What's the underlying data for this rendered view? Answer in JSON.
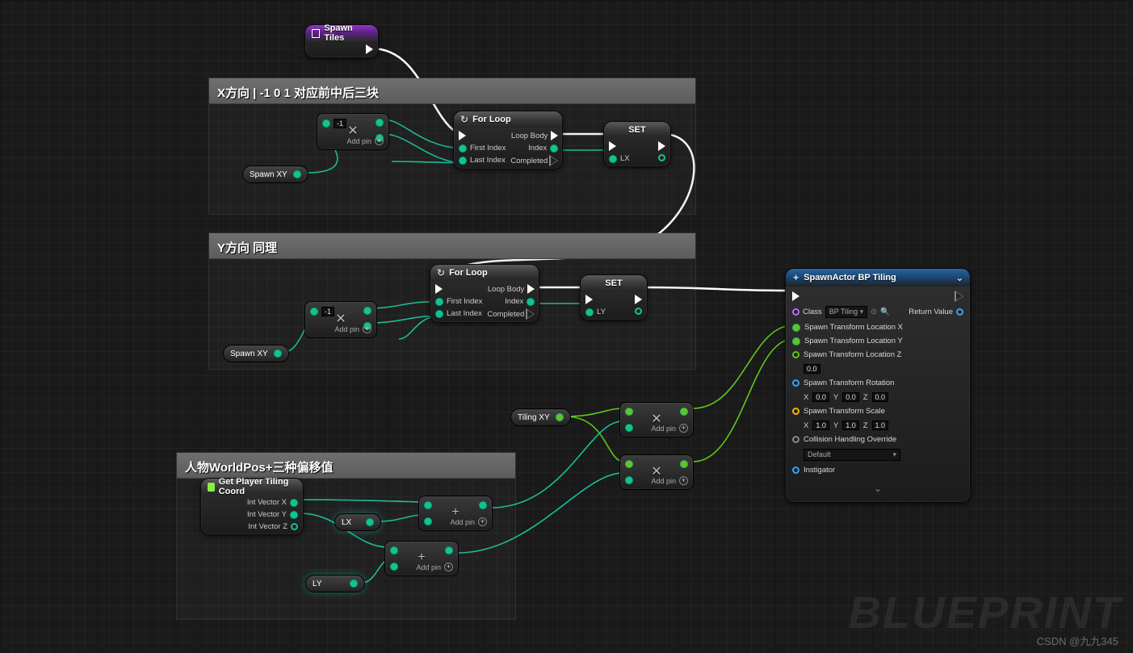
{
  "event": {
    "title": "Spawn Tiles"
  },
  "comments": {
    "x": {
      "title": "X方向 | -1 0 1 对应前中后三块"
    },
    "y": {
      "title": "Y方向 同理"
    },
    "w": {
      "title": "人物WorldPos+三种偏移值"
    }
  },
  "forloop": {
    "title": "For Loop",
    "first": "First Index",
    "last": "Last Index",
    "body": "Loop Body",
    "index": "Index",
    "completed": "Completed"
  },
  "set": {
    "title": "SET",
    "lx": "LX",
    "ly": "LY"
  },
  "makearr": {
    "addpin": "Add pin",
    "neg1": "-1"
  },
  "vars": {
    "spawnxy": "Spawn XY",
    "tilingxy": "Tiling XY",
    "lx": "LX",
    "ly": "LY"
  },
  "getplayer": {
    "title": "Get Player Tiling Coord",
    "x": "Int Vector X",
    "y": "Int Vector Y",
    "z": "Int Vector Z"
  },
  "spawn": {
    "title": "SpawnActor BP Tiling",
    "class": "Class",
    "classval": "BP Tiling",
    "retval": "Return Value",
    "locx": "Spawn Transform Location X",
    "locy": "Spawn Transform Location Y",
    "locz": "Spawn Transform Location Z",
    "loczval": "0.0",
    "rot": "Spawn Transform Rotation",
    "rx": "0.0",
    "ry": "0.0",
    "rz": "0.0",
    "scale": "Spawn Transform Scale",
    "sx": "1.0",
    "sy": "1.0",
    "sz": "1.0",
    "coll": "Collision Handling Override",
    "collval": "Default",
    "instig": "Instigator"
  },
  "ui": {
    "addpin": "Add pin",
    "X": "X",
    "Y": "Y",
    "Z": "Z"
  },
  "wm1": "BLUEPRINT",
  "wm2": "CSDN @九九345"
}
